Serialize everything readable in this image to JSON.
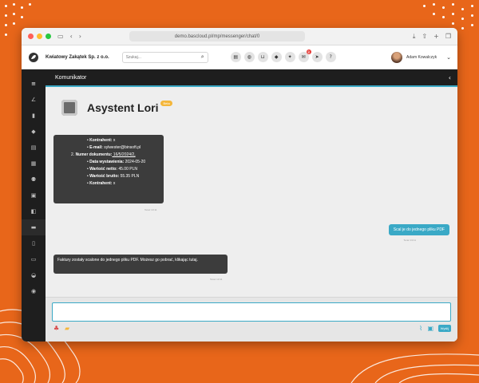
{
  "browser": {
    "url": "demo.bascloud.pl/mp/messenger/chat/0"
  },
  "appbar": {
    "company": "Kwiatowy Zakątek Sp. z o.o.",
    "search_placeholder": "Szukaj...",
    "user_name": "Adam Kowalczyk",
    "notification_count": "8"
  },
  "page": {
    "title": "Komunikator"
  },
  "bot": {
    "name": "Asystent Lori",
    "badge": "Beta"
  },
  "messages": {
    "m1": {
      "l1_label": "Kontrahent:",
      "l1_value": " x",
      "l2_label": "E-mail:",
      "l2_value": " sylwester@binsoft.pl",
      "l3_num": "2.",
      "l3_label": "Numer dokumentu:",
      "l3_value": " 16/5/2024/2,",
      "l4_label": "Data wystawienia:",
      "l4_value": " 2024-05-20",
      "l5_label": "Wartość netto:",
      "l5_value": " 45.00 PLN",
      "l6_label": "Wartość brutto:",
      "l6_value": " 55.35 PLN",
      "l7_label": "Kontrahent:",
      "l7_value": " x",
      "time": "Teraz 13:11"
    },
    "m2": {
      "text": "Scal je do jednego pliku PDF",
      "time": "Teraz 13:11"
    },
    "m3": {
      "text": "Faktury zostały scalone do jednego pliku PDF. Możesz go pobrać, klikając tutaj.",
      "time": "Teraz 13:11"
    }
  },
  "composer": {
    "send_label": "Wyślij"
  }
}
